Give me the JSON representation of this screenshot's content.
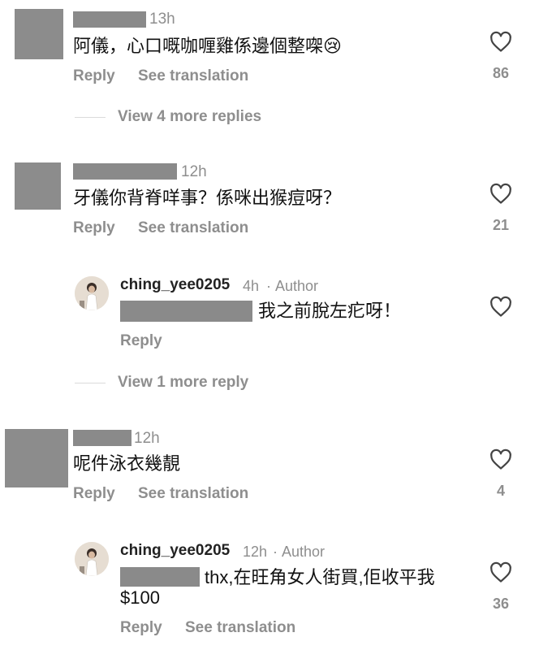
{
  "comments": [
    {
      "time": "13h",
      "text": "阿儀，心口嘅咖喱雞係邊個整㗎😢",
      "reply_label": "Reply",
      "translate_label": "See translation",
      "likes": "86",
      "view_more": "View 4 more replies"
    },
    {
      "time": "12h",
      "text": "牙儀你背脊咩事？係咪出猴痘呀？",
      "reply_label": "Reply",
      "translate_label": "See translation",
      "likes": "21",
      "view_more": "View 1 more reply"
    },
    {
      "time": "12h",
      "text": "呢件泳衣幾靚",
      "reply_label": "Reply",
      "translate_label": "See translation",
      "likes": "4"
    }
  ],
  "replies": [
    {
      "username": "ching_yee0205",
      "time": "4h",
      "author_label": "Author",
      "text": "我之前脫左疕呀！",
      "reply_label": "Reply"
    },
    {
      "username": "ching_yee0205",
      "time": "12h",
      "author_label": "Author",
      "text_line1": "thx,在旺角女人街買,佢收平我",
      "text_line2": "$100",
      "reply_label": "Reply",
      "translate_label": "See translation",
      "likes": "36"
    }
  ],
  "separator": "·",
  "icons": {
    "like": "heart-outline-icon",
    "avatar": "author-avatar"
  }
}
